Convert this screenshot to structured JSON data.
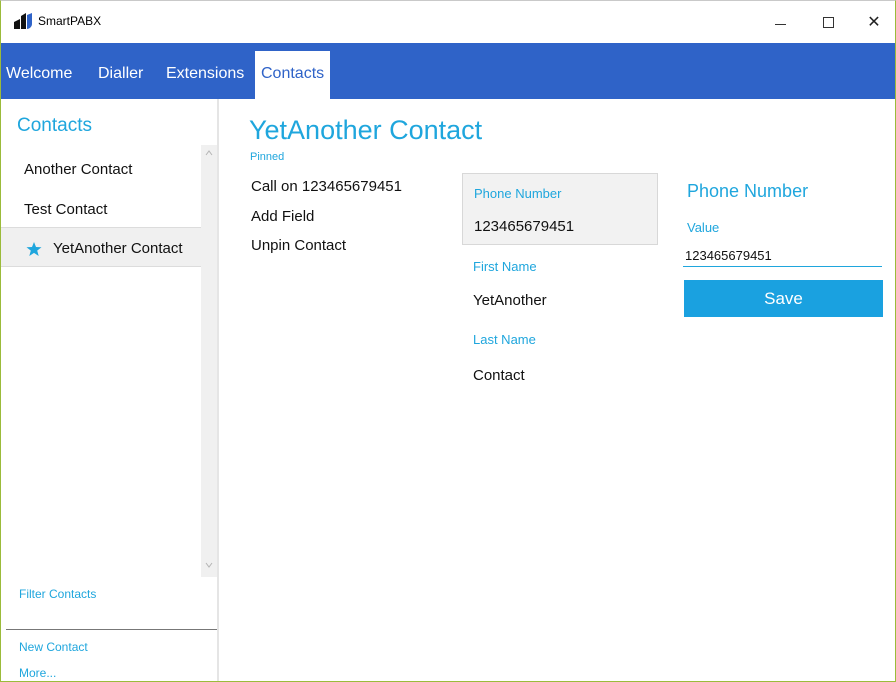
{
  "window": {
    "title": "SmartPABX",
    "controls": {
      "minimize": "",
      "maximize": "",
      "close": "✕"
    }
  },
  "nav": {
    "tabs": [
      {
        "label": "Welcome"
      },
      {
        "label": "Dialler"
      },
      {
        "label": "Extensions"
      },
      {
        "label": "Contacts",
        "active": true
      }
    ]
  },
  "sidebar": {
    "title": "Contacts",
    "contacts": [
      {
        "label": "Another Contact",
        "pinned": false
      },
      {
        "label": "Test Contact",
        "pinned": false
      },
      {
        "label": "YetAnother Contact",
        "pinned": true,
        "selected": true
      }
    ],
    "filter_label": "Filter Contacts",
    "new_contact_label": "New Contact",
    "more_label": "More..."
  },
  "detail": {
    "name": "YetAnother Contact",
    "status": "Pinned",
    "actions": {
      "call": "Call on 123465679451",
      "add_field": "Add Field",
      "unpin": "Unpin Contact"
    },
    "fields": {
      "phone": {
        "label": "Phone Number",
        "value": "123465679451"
      },
      "first_name": {
        "label": "First Name",
        "value": "YetAnother"
      },
      "last_name": {
        "label": "Last Name",
        "value": "Contact"
      }
    }
  },
  "editor": {
    "title": "Phone Number",
    "value_label": "Value",
    "value": "123465679451",
    "save_label": "Save"
  },
  "colors": {
    "accent": "#1fa6dd",
    "nav_bar": "#2f63c8",
    "save_button": "#1aa1e0"
  }
}
